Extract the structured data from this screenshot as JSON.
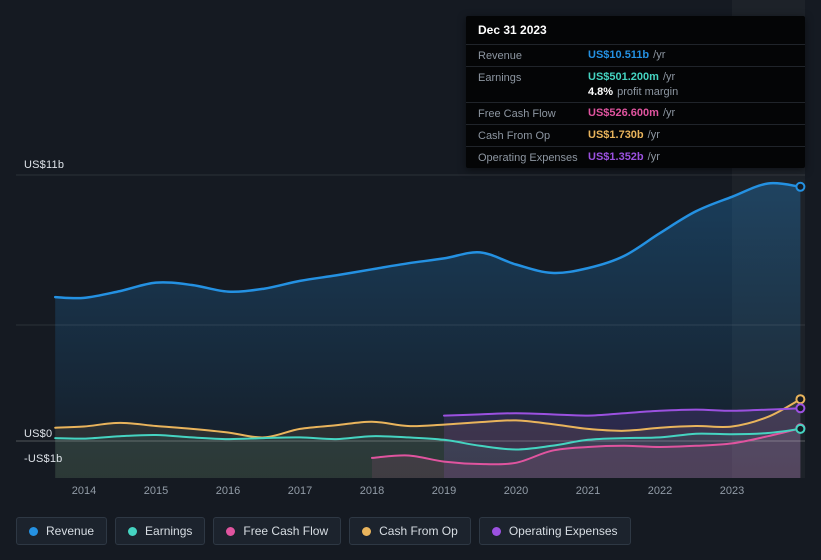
{
  "colors": {
    "background": "#151a22",
    "tooltip_bg": "#040506"
  },
  "tooltip": {
    "date": "Dec 31 2023",
    "rows": [
      {
        "label": "Revenue",
        "value": "US$10.511b",
        "suffix": "/yr",
        "color": "#2491e2"
      },
      {
        "label": "Earnings",
        "value": "US$501.200m",
        "suffix": "/yr",
        "color": "#45d4c1",
        "extra_value": "4.8%",
        "extra_label": "profit margin"
      },
      {
        "label": "Free Cash Flow",
        "value": "US$526.600m",
        "suffix": "/yr",
        "color": "#e0549f"
      },
      {
        "label": "Cash From Op",
        "value": "US$1.730b",
        "suffix": "/yr",
        "color": "#e9b45c"
      },
      {
        "label": "Operating Expenses",
        "value": "US$1.352b",
        "suffix": "/yr",
        "color": "#9b51e0"
      }
    ]
  },
  "axis": {
    "y_labels": [
      "US$11b",
      "US$0",
      "-US$1b"
    ],
    "x_labels": [
      "2014",
      "2015",
      "2016",
      "2017",
      "2018",
      "2019",
      "2020",
      "2021",
      "2022",
      "2023"
    ]
  },
  "legend": [
    {
      "label": "Revenue",
      "color": "#2491e2"
    },
    {
      "label": "Earnings",
      "color": "#45d4c1"
    },
    {
      "label": "Free Cash Flow",
      "color": "#e0549f"
    },
    {
      "label": "Cash From Op",
      "color": "#e9b45c"
    },
    {
      "label": "Operating Expenses",
      "color": "#9b51e0"
    }
  ],
  "chart_data": {
    "type": "line",
    "title": "",
    "y_unit": "US$ billions",
    "ylim": [
      -1.5,
      11
    ],
    "grid": "horizontal",
    "legend_position": "bottom",
    "highlight_band_start": 2023,
    "x_ticks": [
      2014,
      2015,
      2016,
      2017,
      2018,
      2019,
      2020,
      2021,
      2022,
      2023
    ],
    "x": [
      2013.6,
      2014,
      2014.5,
      2015,
      2015.5,
      2016,
      2016.5,
      2017,
      2017.5,
      2018,
      2018.5,
      2019,
      2019.5,
      2020,
      2020.5,
      2021,
      2021.5,
      2022,
      2022.5,
      2023,
      2023.5,
      2023.95
    ],
    "series": [
      {
        "name": "Revenue",
        "color": "#2491e2",
        "values": [
          5.95,
          5.92,
          6.2,
          6.55,
          6.45,
          6.18,
          6.3,
          6.62,
          6.85,
          7.1,
          7.35,
          7.55,
          7.8,
          7.3,
          6.95,
          7.15,
          7.65,
          8.6,
          9.5,
          10.1,
          10.65,
          10.511
        ]
      },
      {
        "name": "Earnings",
        "color": "#45d4c1",
        "values": [
          0.12,
          0.1,
          0.2,
          0.25,
          0.15,
          0.08,
          0.12,
          0.15,
          0.08,
          0.2,
          0.15,
          0.05,
          -0.2,
          -0.35,
          -0.2,
          0.05,
          0.12,
          0.15,
          0.3,
          0.28,
          0.33,
          0.501
        ]
      },
      {
        "name": "Free Cash Flow",
        "color": "#e0549f",
        "values": [
          null,
          null,
          null,
          null,
          null,
          null,
          null,
          null,
          null,
          -0.7,
          -0.6,
          -0.85,
          -0.95,
          -0.9,
          -0.4,
          -0.25,
          -0.2,
          -0.25,
          -0.2,
          -0.1,
          0.2,
          0.527
        ]
      },
      {
        "name": "Cash From Op",
        "color": "#e9b45c",
        "values": [
          0.55,
          0.6,
          0.75,
          0.62,
          0.5,
          0.35,
          0.15,
          0.5,
          0.65,
          0.8,
          0.62,
          0.68,
          0.78,
          0.85,
          0.7,
          0.5,
          0.42,
          0.55,
          0.62,
          0.6,
          1.0,
          1.73
        ]
      },
      {
        "name": "Operating Expenses",
        "color": "#9b51e0",
        "values": [
          null,
          null,
          null,
          null,
          null,
          null,
          null,
          null,
          null,
          null,
          null,
          1.05,
          1.1,
          1.15,
          1.1,
          1.05,
          1.15,
          1.25,
          1.3,
          1.25,
          1.3,
          1.352
        ]
      }
    ]
  }
}
